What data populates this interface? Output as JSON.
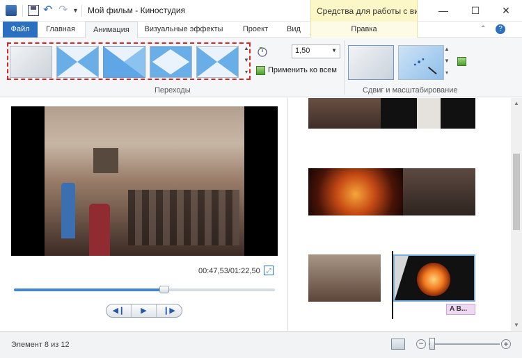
{
  "window": {
    "title": "Мой фильм - Киностудия",
    "context_header": "Средства для работы с ви...",
    "minimize": "—",
    "maximize": "☐",
    "close": "✕"
  },
  "tabs": {
    "file": "Файл",
    "home": "Главная",
    "animation": "Анимация",
    "visual_effects": "Визуальные эффекты",
    "project": "Проект",
    "view": "Вид",
    "edit": "Правка",
    "help": "?"
  },
  "ribbon": {
    "transitions_label": "Переходы",
    "duration_value": "1,50",
    "apply_all": "Применить ко всем",
    "pan_zoom_label": "Сдвиг и масштабирование"
  },
  "preview": {
    "timecode": "00:47,53/01:22,50",
    "progress": 0.575
  },
  "storyboard": {
    "caption_chip": "A B..."
  },
  "status": {
    "element_text": "Элемент 8 из 12",
    "zoom_out": "−",
    "zoom_in": "+"
  },
  "colors": {
    "accent": "#2b6fc1",
    "context_tab": "#fbf7c6",
    "highlight_box": "#dd2222"
  }
}
